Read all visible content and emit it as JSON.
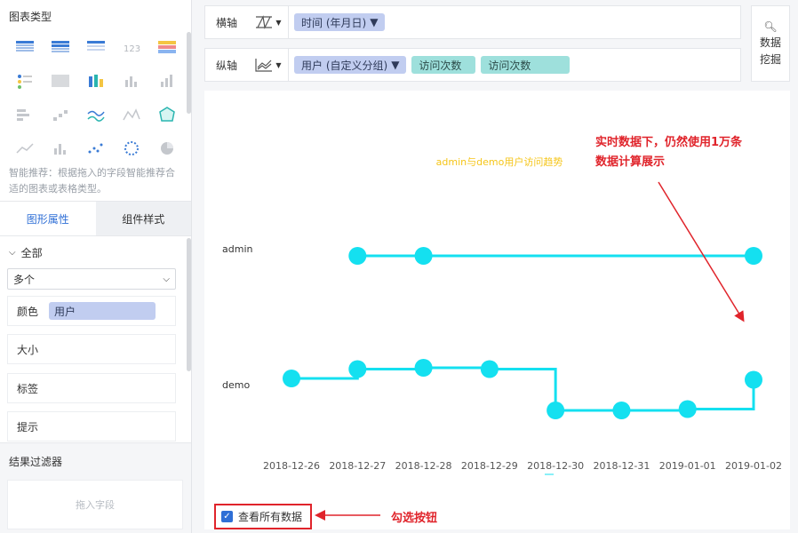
{
  "left_panel": {
    "chart_type_title": "图表类型",
    "hint": "智能推荐：根据拖入的字段智能推荐合适的图表或表格类型。",
    "tabs": [
      {
        "label": "图形属性"
      },
      {
        "label": "组件样式"
      }
    ],
    "all_label": "全部",
    "multi_select": "多个",
    "color_label": "颜色",
    "color_field": "用户",
    "size_label": "大小",
    "tag_label": "标签",
    "tip_label": "提示",
    "filter_title": "结果过滤器",
    "drop_placeholder": "拖入字段"
  },
  "x_axis": {
    "label": "横轴",
    "field": "时间 (年月日)"
  },
  "y_axis": {
    "label": "纵轴",
    "field": "用户 (自定义分组)",
    "measures": [
      "访问次数",
      "访问次数"
    ]
  },
  "data_mining": {
    "line1": "数据",
    "line2": "挖掘"
  },
  "annotations": {
    "realtime_line1": "实时数据下，仍然使用1万条",
    "realtime_line2": "数据计算展示",
    "check_button": "勾选按钮"
  },
  "show_all_label": "查看所有数据",
  "colors": {
    "accent": "#2f6fd6",
    "series": "#14e0f0",
    "annotation": "#e0242b",
    "title": "#f5c518"
  },
  "chart_data": {
    "type": "line",
    "title": "admin与demo用户访问趋势",
    "categories": [
      "2018-12-26",
      "2018-12-27",
      "2018-12-28",
      "2018-12-29",
      "2018-12-30",
      "2018-12-31",
      "2019-01-01",
      "2019-01-02"
    ],
    "rows": [
      "admin",
      "demo"
    ],
    "series": [
      {
        "name": "admin",
        "values": [
          null,
          1,
          1,
          null,
          null,
          null,
          null,
          1
        ]
      },
      {
        "name": "demo",
        "values": [
          0.4,
          0.75,
          0.8,
          0.75,
          -0.8,
          -0.8,
          -0.75,
          0.35
        ]
      }
    ]
  }
}
